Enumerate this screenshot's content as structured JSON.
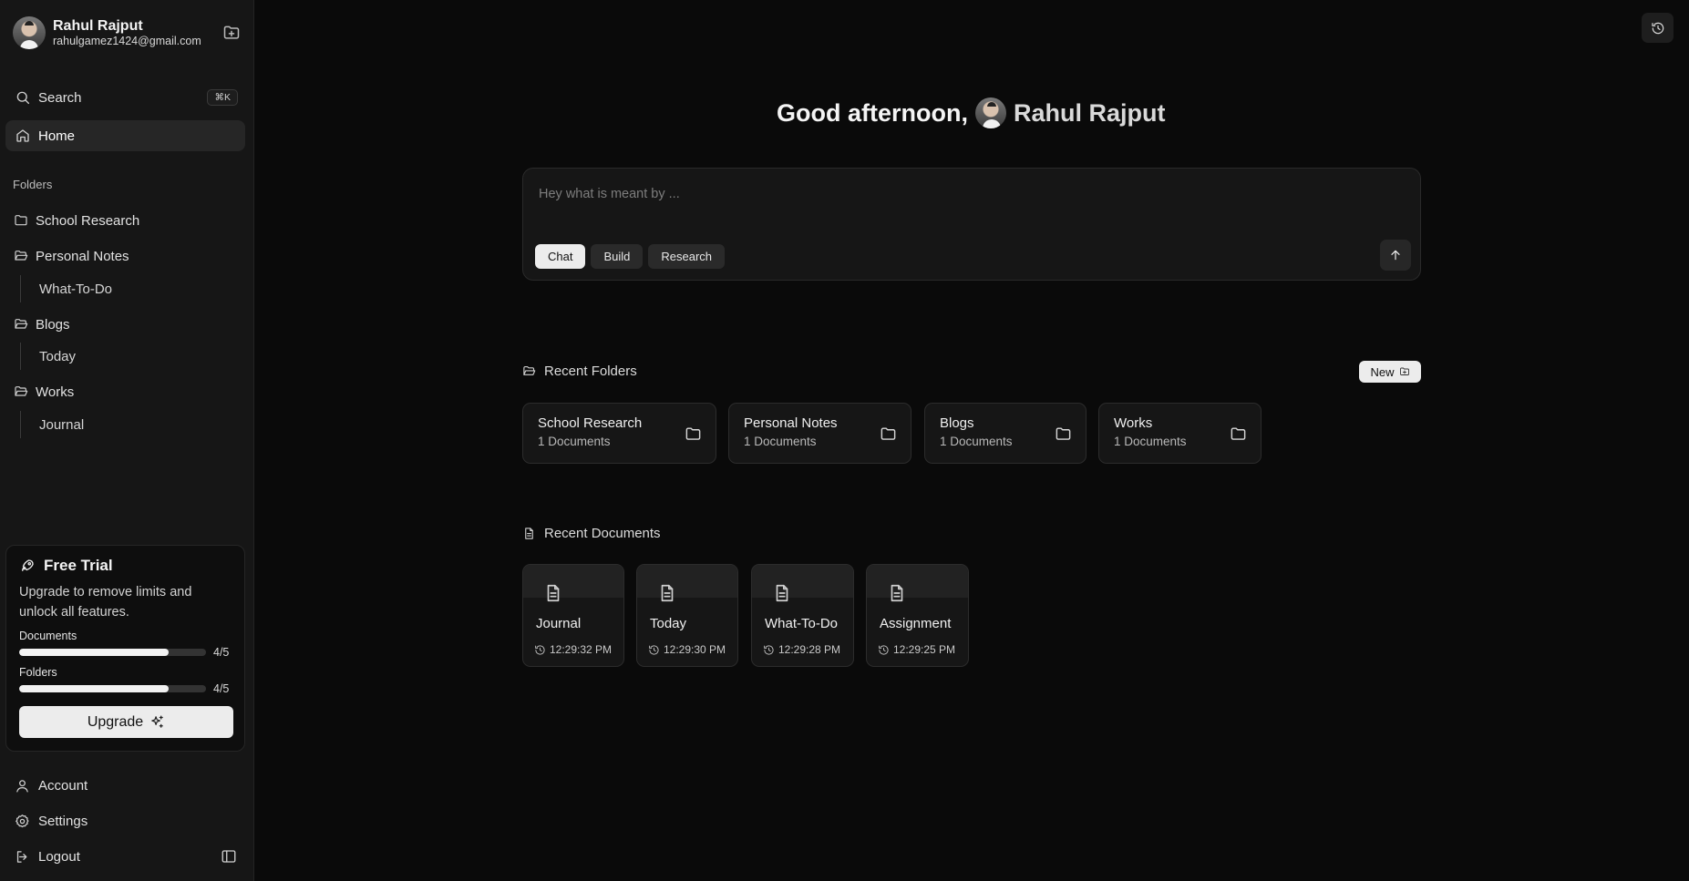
{
  "user": {
    "name": "Rahul Rajput",
    "email": "rahulgamez1424@gmail.com"
  },
  "sidebar": {
    "search_label": "Search",
    "search_shortcut": "⌘K",
    "home_label": "Home",
    "folders_heading": "Folders",
    "folders": [
      {
        "label": "School Research",
        "icon": "folder-icon",
        "children": []
      },
      {
        "label": "Personal Notes",
        "icon": "folder-open-icon",
        "children": [
          "What-To-Do"
        ]
      },
      {
        "label": "Blogs",
        "icon": "folder-open-icon",
        "children": [
          "Today"
        ]
      },
      {
        "label": "Works",
        "icon": "folder-open-icon",
        "children": [
          "Journal"
        ]
      }
    ],
    "trial": {
      "title": "Free Trial",
      "description": "Upgrade to remove limits and unlock all features.",
      "documents_label": "Documents",
      "documents_count": "4/5",
      "documents_fraction": 0.8,
      "folders_label": "Folders",
      "folders_count": "4/5",
      "folders_fraction": 0.8,
      "upgrade_label": "Upgrade"
    },
    "account_label": "Account",
    "settings_label": "Settings",
    "logout_label": "Logout"
  },
  "main": {
    "greeting": "Good afternoon,",
    "greeting_name": "Rahul Rajput",
    "prompt": {
      "placeholder": "Hey what is meant by ...",
      "value": "",
      "modes": [
        {
          "label": "Chat",
          "active": true
        },
        {
          "label": "Build",
          "active": false
        },
        {
          "label": "Research",
          "active": false
        }
      ]
    },
    "recent_folders_title": "Recent Folders",
    "new_label": "New",
    "recent_folders": [
      {
        "name": "School Research",
        "count": "1 Documents"
      },
      {
        "name": "Personal Notes",
        "count": "1 Documents"
      },
      {
        "name": "Blogs",
        "count": "1 Documents"
      },
      {
        "name": "Works",
        "count": "1 Documents"
      }
    ],
    "recent_documents_title": "Recent Documents",
    "recent_documents": [
      {
        "name": "Journal",
        "time": "12:29:32 PM"
      },
      {
        "name": "Today",
        "time": "12:29:30 PM"
      },
      {
        "name": "What-To-Do",
        "time": "12:29:28 PM"
      },
      {
        "name": "Assignment",
        "time": "12:29:25 PM"
      }
    ]
  },
  "colors": {
    "background": "#0a0a0a",
    "sidebar": "#161616",
    "accent": "#ececec"
  }
}
